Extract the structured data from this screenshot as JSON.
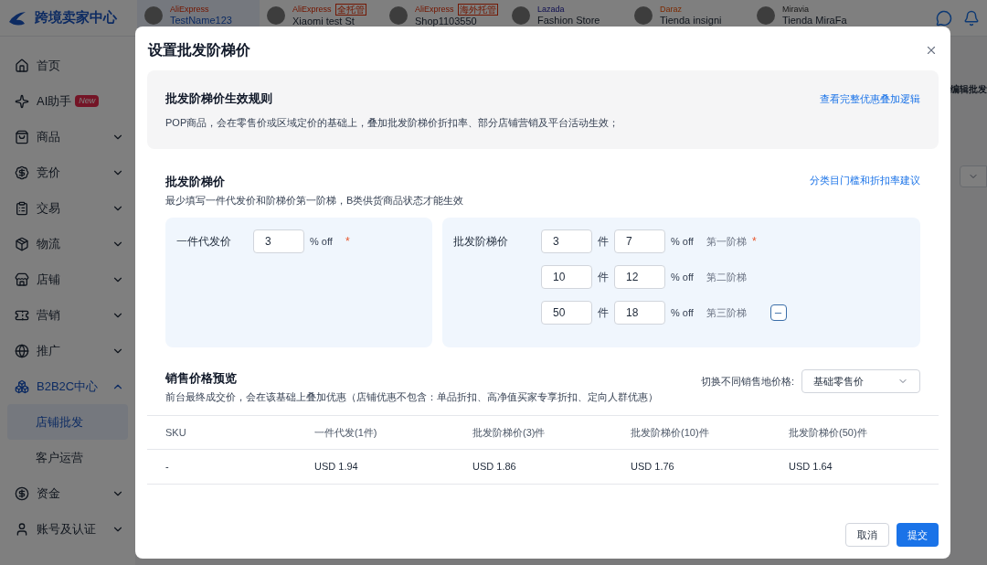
{
  "top_bar": {
    "logo_text": "跨境卖家中心",
    "stores": [
      {
        "platform": "AliExpress",
        "name": "TestName123",
        "selected": true
      },
      {
        "platform": "AliExpress",
        "tag": "全托管",
        "name": "Xiaomi test St",
        "selected": false
      },
      {
        "platform": "AliExpress",
        "tag": "海外托管",
        "name": "Shop1103550",
        "selected": false
      },
      {
        "platform": "Lazada",
        "name": "Fashion Store",
        "selected": false
      },
      {
        "platform": "Daraz",
        "name": "Tienda insigni",
        "selected": false
      },
      {
        "platform": "Miravia",
        "name": "Tienda MiraFa",
        "selected": false
      }
    ]
  },
  "sidebar": {
    "items": [
      {
        "kind": "home",
        "label": "首页"
      },
      {
        "kind": "ai",
        "label": "AI助手",
        "badge": "New"
      },
      {
        "kind": "goods",
        "label": "商品",
        "expanded": false
      },
      {
        "kind": "bid",
        "label": "竞价",
        "expanded": false
      },
      {
        "kind": "trade",
        "label": "交易",
        "expanded": false
      },
      {
        "kind": "logistics",
        "label": "物流",
        "expanded": false
      },
      {
        "kind": "store",
        "label": "店铺",
        "expanded": false
      },
      {
        "kind": "marketing",
        "label": "营销",
        "expanded": false
      },
      {
        "kind": "promo",
        "label": "推广",
        "expanded": false
      },
      {
        "kind": "b2b",
        "label": "B2B2C中心",
        "expanded": true,
        "children": [
          {
            "label": "店铺批发",
            "selected": true
          },
          {
            "label": "客户运营",
            "selected": false
          }
        ]
      },
      {
        "kind": "fund",
        "label": "资金",
        "expanded": false
      },
      {
        "kind": "account",
        "label": "账号及认证",
        "expanded": false
      }
    ]
  },
  "background": {
    "button_text": "编辑批发"
  },
  "dialog": {
    "title": "设置批发阶梯价",
    "rule_card": {
      "title": "批发阶梯价生效规则",
      "description": "POP商品，会在零售价或区域定价的基础上，叠加批发阶梯价折扣率、部分店铺营销及平台活动生效；",
      "link": "查看完整优惠叠加逻辑"
    },
    "tier_section": {
      "title": "批发阶梯价",
      "subtitle": "最少填写一件代发价和阶梯价第一阶梯，B类供货商品状态才能生效",
      "link": "分类目门槛和折扣率建议",
      "dropship": {
        "label": "一件代发价",
        "value": "3",
        "unit": "% off",
        "required_mark": "*"
      },
      "tiers": {
        "label": "批发阶梯价",
        "rows": [
          {
            "quantity": "3",
            "quantity_unit": "件",
            "discount": "7",
            "unit": "% off",
            "name": "第一阶梯",
            "required_mark": "*",
            "removable": false
          },
          {
            "quantity": "10",
            "quantity_unit": "件",
            "discount": "12",
            "unit": "% off",
            "name": "第二阶梯",
            "removable": false
          },
          {
            "quantity": "50",
            "quantity_unit": "件",
            "discount": "18",
            "unit": "% off",
            "name": "第三阶梯",
            "removable": true
          }
        ]
      }
    },
    "preview": {
      "title": "销售价格预览",
      "description": "前台最终成交价，会在该基础上叠加优惠（店铺优惠不包含：单品折扣、高净值买家专享折扣、定向人群优惠）",
      "switch_label": "切换不同销售地价格:",
      "select_value": "基础零售价",
      "columns": [
        "SKU",
        "一件代发(1件)",
        "批发阶梯价(3)件",
        "批发阶梯价(10)件",
        "批发阶梯价(50)件"
      ],
      "rows": [
        [
          "-",
          "USD 1.94",
          "USD 1.86",
          "USD 1.76",
          "USD 1.64"
        ]
      ]
    },
    "buttons": {
      "cancel": "取消",
      "submit": "提交"
    }
  }
}
